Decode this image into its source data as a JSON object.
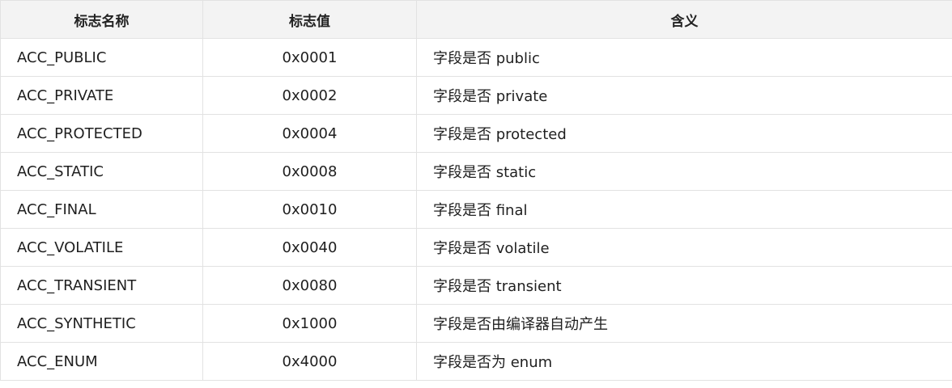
{
  "table": {
    "headers": [
      "标志名称",
      "标志值",
      "含义"
    ],
    "rows": [
      [
        "ACC_PUBLIC",
        "0x0001",
        "字段是否 public"
      ],
      [
        "ACC_PRIVATE",
        "0x0002",
        "字段是否 private"
      ],
      [
        "ACC_PROTECTED",
        "0x0004",
        "字段是否 protected"
      ],
      [
        "ACC_STATIC",
        "0x0008",
        "字段是否 static"
      ],
      [
        "ACC_FINAL",
        "0x0010",
        "字段是否 final"
      ],
      [
        "ACC_VOLATILE",
        "0x0040",
        "字段是否 volatile"
      ],
      [
        "ACC_TRANSIENT",
        "0x0080",
        "字段是否 transient"
      ],
      [
        "ACC_SYNTHETIC",
        "0x1000",
        "字段是否由编译器自动产生"
      ],
      [
        "ACC_ENUM",
        "0x4000",
        "字段是否为 enum"
      ]
    ]
  }
}
